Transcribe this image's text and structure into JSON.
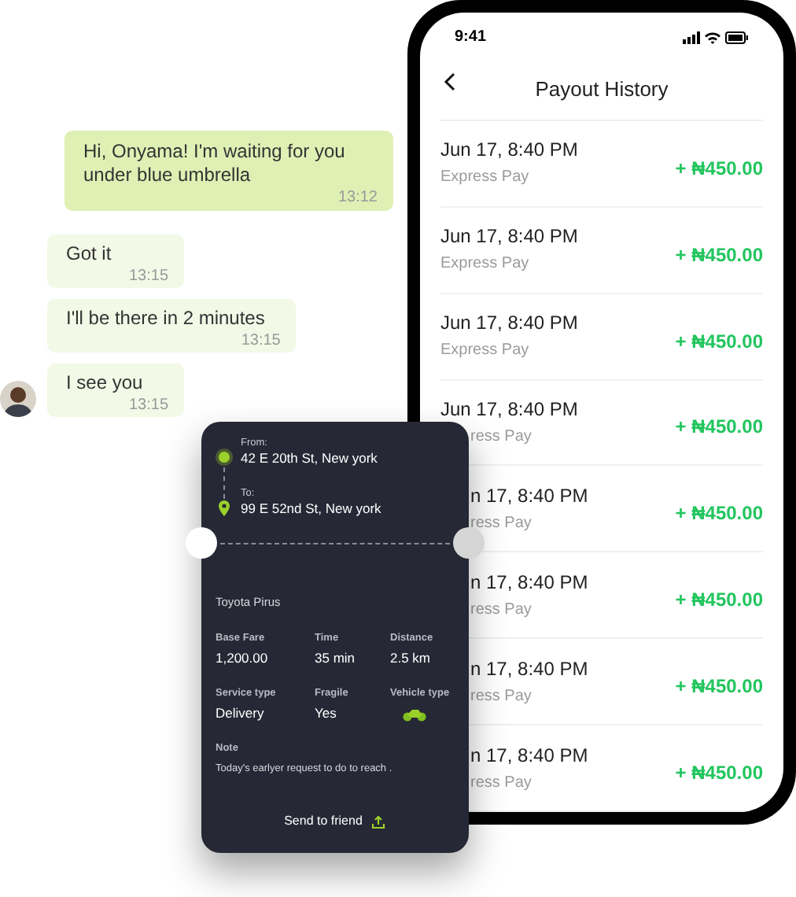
{
  "chat": {
    "messages": [
      {
        "text": "Hi, Onyama! I'm waiting for you under blue umbrella",
        "time": "13:12",
        "outgoing": true
      },
      {
        "text": "Got it",
        "time": "13:15",
        "outgoing": false
      },
      {
        "text": "I'll be there in 2 minutes",
        "time": "13:15",
        "outgoing": false
      },
      {
        "text": "I see you",
        "time": "13:15",
        "outgoing": false
      }
    ]
  },
  "phone": {
    "status_bar": {
      "time": "9:41"
    },
    "header": {
      "title": "Payout History"
    },
    "payouts": [
      {
        "kind": "full",
        "date": "Jun 17, 8:40 PM",
        "method": "Express Pay",
        "amount": "+ ₦450.00"
      },
      {
        "kind": "full",
        "date": "Jun 17, 8:40 PM",
        "method": "Express Pay",
        "amount": "+ ₦450.00"
      },
      {
        "kind": "full",
        "date": "Jun 17, 8:40 PM",
        "method": "Express Pay",
        "amount": "+ ₦450.00"
      },
      {
        "kind": "method_hidden",
        "date": "Jun 17, 8:40 PM",
        "method": "ress Pay",
        "amount": "+ ₦450.00"
      },
      {
        "kind": "partial",
        "date": "n 17, 8:40 PM",
        "method": "ress Pay",
        "amount": "+ ₦450.00"
      },
      {
        "kind": "partial",
        "date": "n 17, 8:40 PM",
        "method": "ress Pay",
        "amount": "+ ₦450.00"
      },
      {
        "kind": "partial",
        "date": "n 17, 8:40 PM",
        "method": "ress Pay",
        "amount": "+ ₦450.00"
      },
      {
        "kind": "partial",
        "date": "n 17, 8:40 PM",
        "method": "ress Pay",
        "amount": "+ ₦450.00"
      }
    ]
  },
  "trip_card": {
    "from_label": "From:",
    "from": "42 E 20th St, New york",
    "to_label": "To:",
    "to": "99 E 52nd St, New york",
    "vehicle": "Toyota Pirus",
    "details": [
      {
        "kind": "text",
        "label": "Base Fare",
        "value": "1,200.00"
      },
      {
        "kind": "text",
        "label": "Time",
        "value": "35 min"
      },
      {
        "kind": "text",
        "label": "Distance",
        "value": "2.5 km"
      },
      {
        "kind": "text",
        "label": "Service type",
        "value": "Delivery"
      },
      {
        "kind": "text",
        "label": "Fragile",
        "value": "Yes"
      },
      {
        "kind": "icon",
        "label": "Vehicle type"
      }
    ],
    "note_label": "Note",
    "note": "Today's earlyer request to do to reach .",
    "action": "Send to friend"
  }
}
